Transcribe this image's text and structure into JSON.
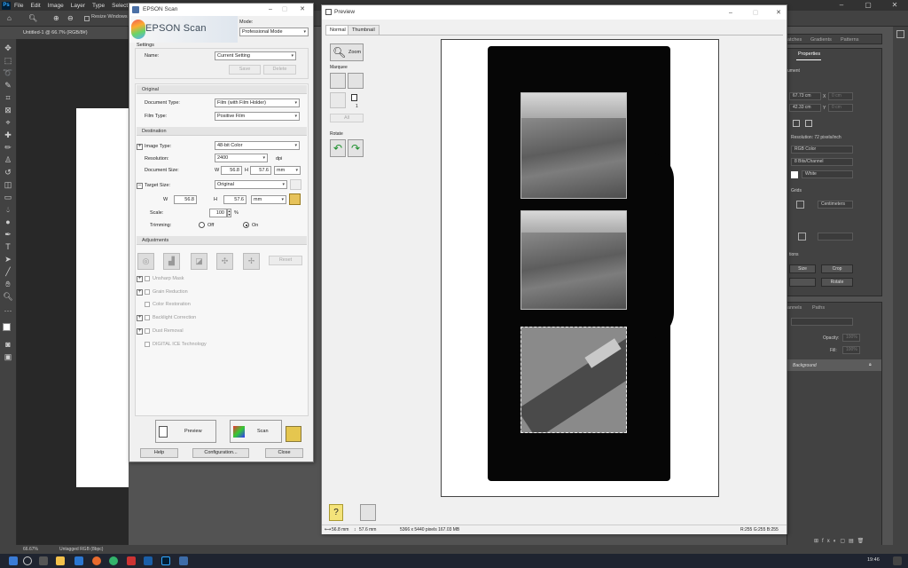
{
  "photoshop": {
    "menu": [
      "File",
      "Edit",
      "Image",
      "Layer",
      "Type",
      "Select",
      "Fi"
    ],
    "options_checkbox": "Resize Windows t",
    "doc_tab": "Untitled-1 @ 66.7% (RGB/8#)",
    "status_zoom": "66.67%",
    "status_profile": "Untagged RGB (8bpc)",
    "panels": {
      "top_tabs": [
        "atches",
        "Gradients",
        "Patterns"
      ],
      "properties_tab": "Properties",
      "properties_heading": "ument",
      "width": "67.73 cm",
      "height": "42.33 cm",
      "x_label": "X",
      "y_label": "Y",
      "x_placeholder": "0 cm",
      "y_placeholder": "0 cm",
      "resolution": "Resolution: 72 pixels/inch",
      "mode": "RGB Color",
      "depth": "8 Bits/Channel",
      "background": "White",
      "grids": "Grids",
      "grid_units": "Centimeters",
      "actions": "tions",
      "btn_size": "Size",
      "btn_crop": "Crop",
      "btn_rotate": "Rotate",
      "layers_tabs": [
        "annels",
        "Paths"
      ],
      "opacity_label": "Opacity:",
      "opacity": "100%",
      "fill_label": "Fill:",
      "fill": "100%",
      "layer_name": "Background"
    }
  },
  "taskbar": {
    "time": "19:46"
  },
  "epson": {
    "title": "EPSON Scan",
    "logo": "EPSON Scan",
    "mode_label": "Mode:",
    "mode_value": "Professional Mode",
    "settings_label": "Settings",
    "name_label": "Name:",
    "name_value": "Current Setting",
    "save": "Save",
    "delete": "Delete",
    "original_section": "Original",
    "document_type_label": "Document Type:",
    "document_type": "Film (with Film Holder)",
    "film_type_label": "Film Type:",
    "film_type": "Positive Film",
    "destination_section": "Destination",
    "image_type_label": "Image Type:",
    "image_type": "48-bit Color",
    "resolution_label": "Resolution:",
    "resolution": "2400",
    "dpi": "dpi",
    "document_size_label": "Document Size:",
    "w_label": "W",
    "h_label": "H",
    "doc_w": "56.8",
    "doc_h": "57.6",
    "unit": "mm",
    "target_size_label": "Target Size:",
    "target_size": "Original",
    "target_w": "56.8",
    "target_h": "57.6",
    "target_unit": "mm",
    "scale_label": "Scale:",
    "scale": "100",
    "percent": "%",
    "trimming_label": "Trimming:",
    "trim_off": "Off",
    "trim_on": "On",
    "adjustments_section": "Adjustments",
    "reset": "Reset",
    "unsharp": "Unsharp Mask",
    "grain": "Grain Reduction",
    "color_restoration": "Color Restoration",
    "backlight": "Backlight Correction",
    "dust": "Dust Removal",
    "digital_ice": "DIGITAL ICE Technology",
    "preview_btn": "Preview",
    "scan_btn": "Scan",
    "help": "Help",
    "configuration": "Configuration...",
    "close": "Close"
  },
  "preview": {
    "title": "Preview",
    "tab_normal": "Normal",
    "tab_thumbnail": "Thumbnail",
    "zoom": "Zoom",
    "marquee": "Marquee",
    "marquee_count": "1",
    "all": "All",
    "rotate": "Rotate",
    "status_w": "56.8 mm",
    "status_h": "57.6 mm",
    "status_pixels": "5366 x 5440 pixels 167.03 MB",
    "status_rgb": "R:255 G:255 B:255"
  }
}
